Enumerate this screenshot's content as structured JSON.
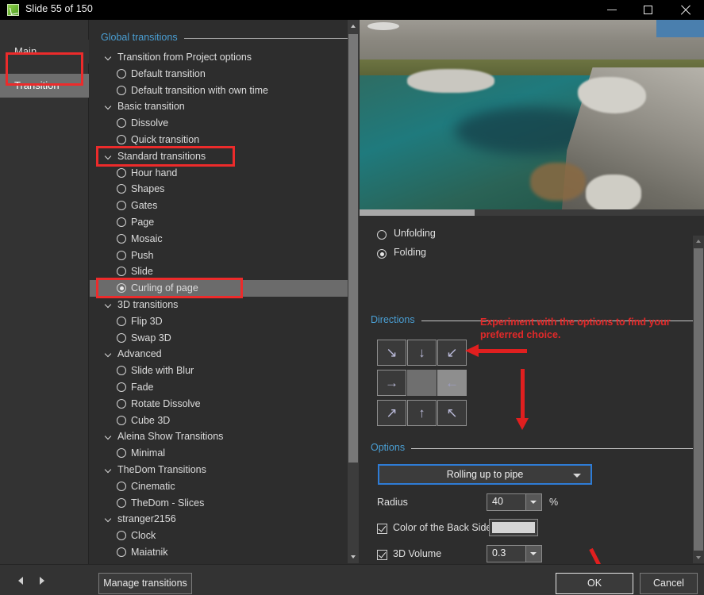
{
  "window": {
    "title": "Slide 55 of 150",
    "icon": "slide-app-icon",
    "controls": {
      "minimize": "minimize-icon",
      "maximize": "maximize-icon",
      "close": "close-icon"
    }
  },
  "sidebar": {
    "items": [
      {
        "label": "Main",
        "selected": false
      },
      {
        "label": "Transition",
        "selected": true
      }
    ]
  },
  "tree": {
    "header": "Global transitions",
    "rows": [
      {
        "type": "group",
        "label": "Transition from Project options",
        "indent": 0
      },
      {
        "type": "radio",
        "label": "Default transition",
        "checked": false
      },
      {
        "type": "radio",
        "label": "Default transition with own time",
        "checked": false
      },
      {
        "type": "group",
        "label": "Basic transition",
        "indent": 0
      },
      {
        "type": "radio",
        "label": "Dissolve",
        "checked": false
      },
      {
        "type": "radio",
        "label": "Quick transition",
        "checked": false
      },
      {
        "type": "group",
        "label": "Standard transitions",
        "indent": 0,
        "highlighted": true
      },
      {
        "type": "radio",
        "label": "Hour hand",
        "checked": false
      },
      {
        "type": "radio",
        "label": "Shapes",
        "checked": false
      },
      {
        "type": "radio",
        "label": "Gates",
        "checked": false
      },
      {
        "type": "radio",
        "label": "Page",
        "checked": false
      },
      {
        "type": "radio",
        "label": "Mosaic",
        "checked": false
      },
      {
        "type": "radio",
        "label": "Push",
        "checked": false
      },
      {
        "type": "radio",
        "label": "Slide",
        "checked": false
      },
      {
        "type": "radio",
        "label": "Curling of page",
        "checked": true,
        "selected": true,
        "highlighted": true
      },
      {
        "type": "group",
        "label": "3D transitions",
        "indent": 0
      },
      {
        "type": "radio",
        "label": "Flip 3D",
        "checked": false
      },
      {
        "type": "radio",
        "label": "Swap 3D",
        "checked": false
      },
      {
        "type": "group",
        "label": "Advanced",
        "indent": 0
      },
      {
        "type": "radio",
        "label": "Slide with Blur",
        "checked": false
      },
      {
        "type": "radio",
        "label": "Fade",
        "checked": false
      },
      {
        "type": "radio",
        "label": "Rotate Dissolve",
        "checked": false
      },
      {
        "type": "radio",
        "label": "Cube 3D",
        "checked": false
      },
      {
        "type": "group",
        "label": "Aleina Show Transitions",
        "indent": 0
      },
      {
        "type": "radio",
        "label": "Minimal",
        "checked": false
      },
      {
        "type": "group",
        "label": "TheDom Transitions",
        "indent": 0
      },
      {
        "type": "radio",
        "label": "Cinematic",
        "checked": false
      },
      {
        "type": "radio",
        "label": "TheDom - Slices",
        "checked": false
      },
      {
        "type": "group",
        "label": "stranger2156",
        "indent": 0
      },
      {
        "type": "radio",
        "label": "Clock",
        "checked": false
      },
      {
        "type": "radio",
        "label": "Maiatnik",
        "checked": false
      }
    ]
  },
  "preview": {
    "name": "slide-preview-image",
    "description": "Alpine stream with granite rocks and turquoise water"
  },
  "options_panel": {
    "mode_radios": [
      {
        "label": "Unfolding",
        "checked": false
      },
      {
        "label": "Folding",
        "checked": true
      }
    ],
    "directions_header": "Directions",
    "directions": [
      {
        "name": "direction-down-right",
        "glyph": "↘",
        "selected": false,
        "blank": false
      },
      {
        "name": "direction-down",
        "glyph": "↓",
        "selected": false,
        "blank": false
      },
      {
        "name": "direction-down-left",
        "glyph": "↙",
        "selected": false,
        "blank": false
      },
      {
        "name": "direction-right",
        "glyph": "→",
        "selected": false,
        "blank": false
      },
      {
        "name": "direction-none",
        "glyph": "",
        "selected": false,
        "blank": true
      },
      {
        "name": "direction-left",
        "glyph": "←",
        "selected": true,
        "blank": false
      },
      {
        "name": "direction-up-right",
        "glyph": "↗",
        "selected": false,
        "blank": false
      },
      {
        "name": "direction-up",
        "glyph": "↑",
        "selected": false,
        "blank": false
      },
      {
        "name": "direction-up-left",
        "glyph": "↖",
        "selected": false,
        "blank": false
      }
    ],
    "options_header": "Options",
    "effect_combo": {
      "value": "Rolling up to pipe",
      "caret": "chevron-down-icon"
    },
    "radius": {
      "label": "Radius",
      "value": "40",
      "unit": "%"
    },
    "back_side_color": {
      "label": "Color of the Back Side",
      "checked": true,
      "color": "#d4d4d4"
    },
    "volume_3d": {
      "label": "3D Volume",
      "checked": true,
      "value": "0.3"
    }
  },
  "annotations": {
    "tip_text": "Experiment with the options to find your preferred choice.",
    "color": "#e22929"
  },
  "footer": {
    "prev": "previous-icon",
    "next": "next-icon",
    "manage": "Manage transitions",
    "ok": "OK",
    "cancel": "Cancel"
  }
}
